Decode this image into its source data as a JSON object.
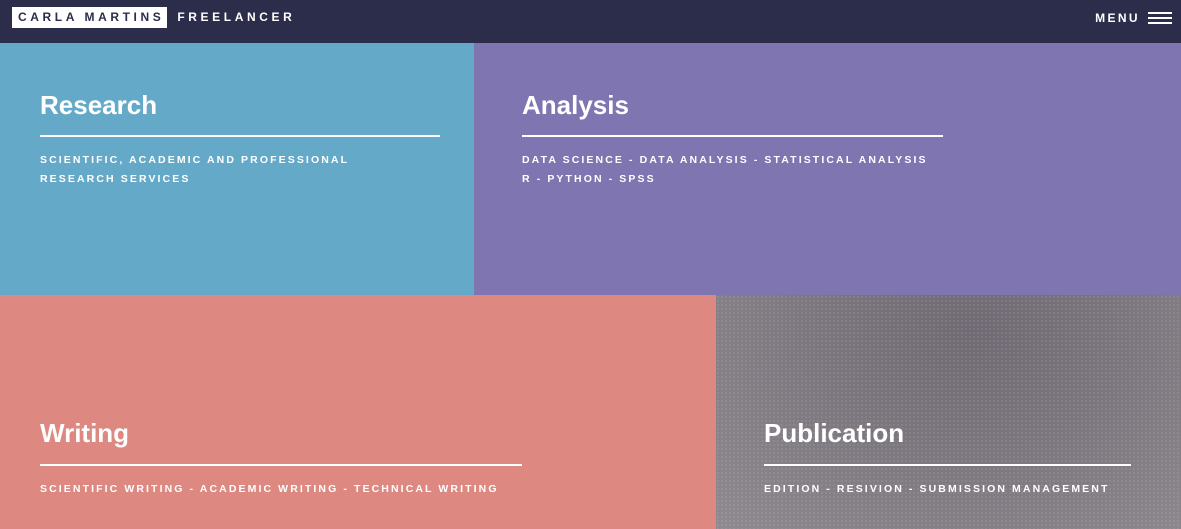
{
  "header": {
    "brand_name": "CARLA MARTINS",
    "brand_sub": "FREELANCER",
    "menu_label": "MENU"
  },
  "tiles": {
    "research": {
      "title": "Research",
      "lines": [
        "SCIENTIFIC, ACADEMIC AND PROFESSIONAL",
        "RESEARCH SERVICES"
      ],
      "color": "#64aac8"
    },
    "analysis": {
      "title": "Analysis",
      "lines": [
        "DATA SCIENCE - DATA ANALYSIS - STATISTICAL ANALYSIS",
        "R - PYTHON - SPSS"
      ],
      "color": "#7e75b1"
    },
    "writing": {
      "title": "Writing",
      "lines": [
        "SCIENTIFIC WRITING - ACADEMIC WRITING - TECHNICAL WRITING"
      ],
      "color": "#dd8880"
    },
    "publication": {
      "title": "Publication",
      "lines": [
        "EDITION - RESIVION - SUBMISSION MANAGEMENT"
      ],
      "color": "#7c777e"
    }
  }
}
